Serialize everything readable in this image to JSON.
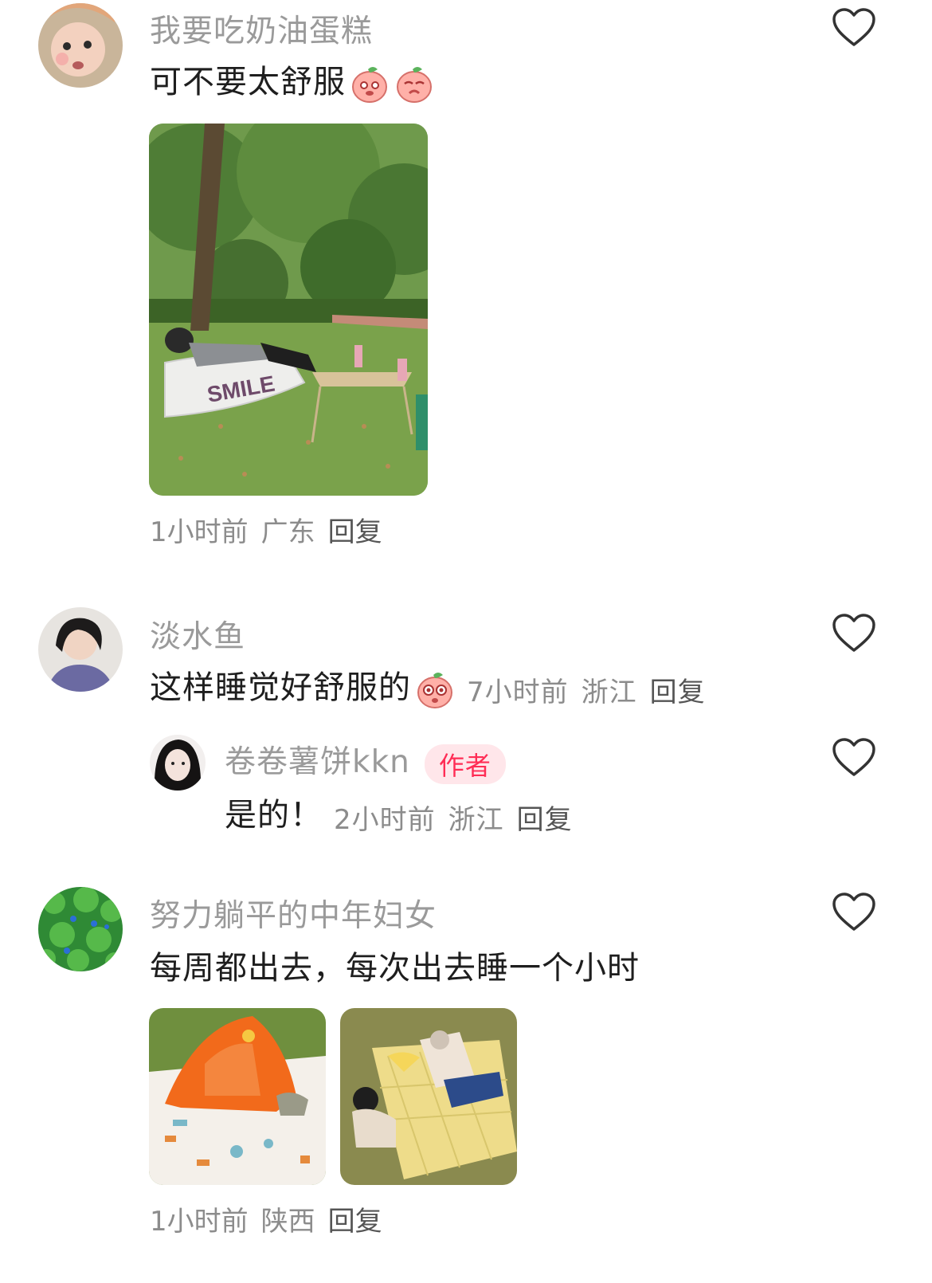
{
  "comments": [
    {
      "username": "我要吃奶油蛋糕",
      "text": "可不要太舒服",
      "meta": {
        "time": "1小时前",
        "location": "广东",
        "reply": "回复"
      }
    },
    {
      "username": "淡水鱼",
      "text": "这样睡觉好舒服的",
      "meta": {
        "time": "7小时前",
        "location": "浙江",
        "reply": "回复"
      },
      "reply_item": {
        "username": "卷卷薯饼kkn",
        "badge": "作者",
        "text": "是的！",
        "meta": {
          "time": "2小时前",
          "location": "浙江",
          "reply": "回复"
        }
      }
    },
    {
      "username": "努力躺平的中年妇女",
      "text": "每周都出去，每次出去睡一个小时",
      "meta": {
        "time": "1小时前",
        "location": "陕西",
        "reply": "回复"
      }
    }
  ],
  "photo_captions": {
    "inflatable_sofa": "SMILE"
  },
  "colors": {
    "username": "#9a9a9a",
    "meta": "#8c8c8c",
    "author_badge_bg": "#ffe6ea",
    "author_badge_text": "#ff2d55"
  },
  "icons": {
    "like": "heart-outline-icon",
    "emoji": "peach-face-emoji"
  }
}
